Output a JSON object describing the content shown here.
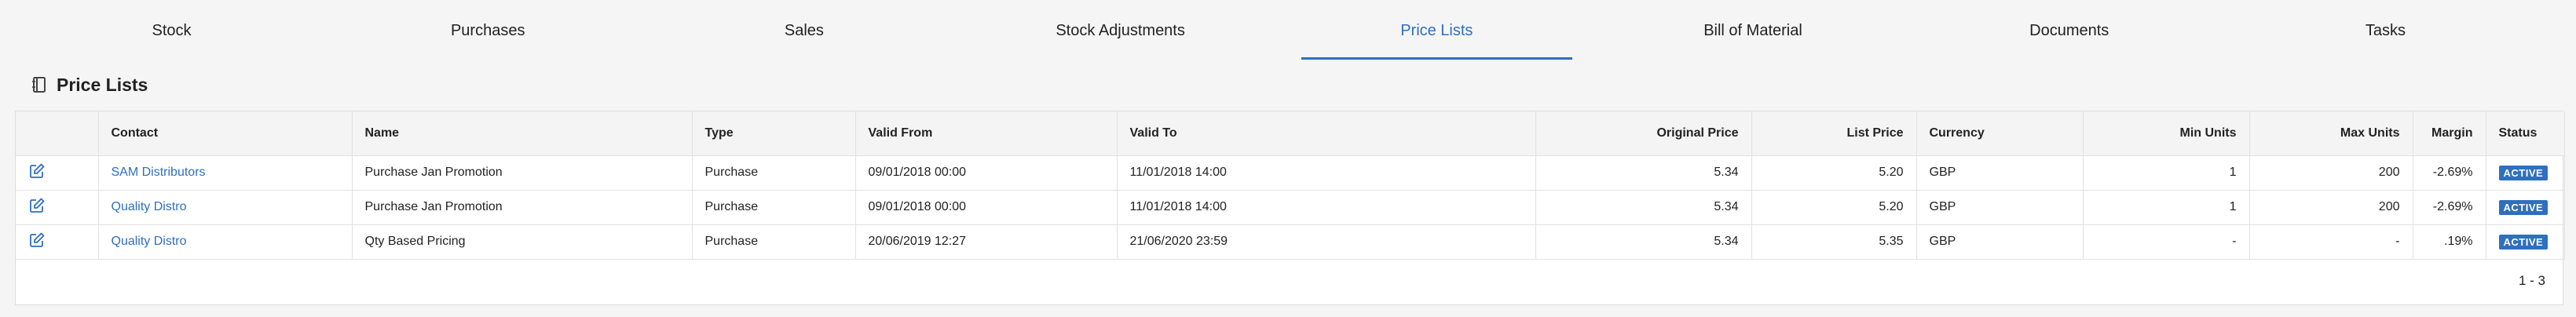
{
  "tabs": [
    {
      "label": "Stock",
      "active": false
    },
    {
      "label": "Purchases",
      "active": false
    },
    {
      "label": "Sales",
      "active": false
    },
    {
      "label": "Stock Adjustments",
      "active": false
    },
    {
      "label": "Price Lists",
      "active": true
    },
    {
      "label": "Bill of Material",
      "active": false
    },
    {
      "label": "Documents",
      "active": false
    },
    {
      "label": "Tasks",
      "active": false
    }
  ],
  "section": {
    "title": "Price Lists",
    "icon": "notebook-icon"
  },
  "table": {
    "headers": {
      "edit": "",
      "contact": "Contact",
      "name": "Name",
      "type": "Type",
      "valid_from": "Valid From",
      "valid_to": "Valid To",
      "original_price": "Original Price",
      "list_price": "List Price",
      "currency": "Currency",
      "min_units": "Min Units",
      "max_units": "Max Units",
      "margin": "Margin",
      "status": "Status"
    },
    "rows": [
      {
        "contact": "SAM Distributors",
        "name": "Purchase Jan Promotion",
        "type": "Purchase",
        "valid_from": "09/01/2018 00:00",
        "valid_to": "11/01/2018 14:00",
        "original_price": "5.34",
        "list_price": "5.20",
        "currency": "GBP",
        "min_units": "1",
        "max_units": "200",
        "margin": "-2.69%",
        "status": "ACTIVE"
      },
      {
        "contact": "Quality Distro",
        "name": "Purchase Jan Promotion",
        "type": "Purchase",
        "valid_from": "09/01/2018 00:00",
        "valid_to": "11/01/2018 14:00",
        "original_price": "5.34",
        "list_price": "5.20",
        "currency": "GBP",
        "min_units": "1",
        "max_units": "200",
        "margin": "-2.69%",
        "status": "ACTIVE"
      },
      {
        "contact": "Quality Distro",
        "name": "Qty Based Pricing",
        "type": "Purchase",
        "valid_from": "20/06/2019 12:27",
        "valid_to": "21/06/2020 23:59",
        "original_price": "5.34",
        "list_price": "5.35",
        "currency": "GBP",
        "min_units": "-",
        "max_units": "-",
        "margin": ".19%",
        "status": "ACTIVE"
      }
    ]
  },
  "pagination": {
    "range": "1 - 3"
  },
  "colors": {
    "accent": "#2f6fbf",
    "header_bg": "#f4f4f4",
    "page_bg": "#f5f5f5"
  }
}
